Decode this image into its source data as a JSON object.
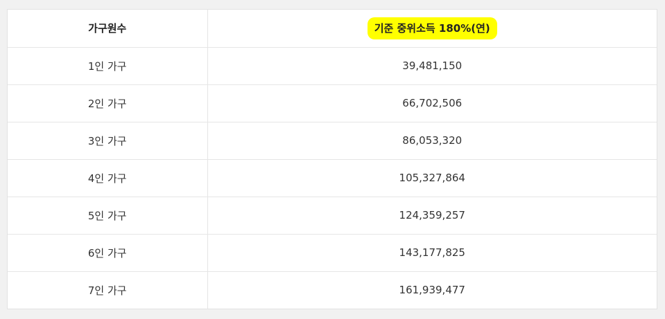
{
  "table": {
    "headers": [
      "가구원수",
      "기준 중위소득 180%(연)"
    ],
    "rows": [
      [
        "1인 가구",
        "39,481,150"
      ],
      [
        "2인 가구",
        "66,702,506"
      ],
      [
        "3인 가구",
        "86,053,320"
      ],
      [
        "4인 가구",
        "105,327,864"
      ],
      [
        "5인 가구",
        "124,359,257"
      ],
      [
        "6인 가구",
        "143,177,825"
      ],
      [
        "7인 가구",
        "161,939,477"
      ]
    ],
    "highlight_color": "#ffff00"
  }
}
